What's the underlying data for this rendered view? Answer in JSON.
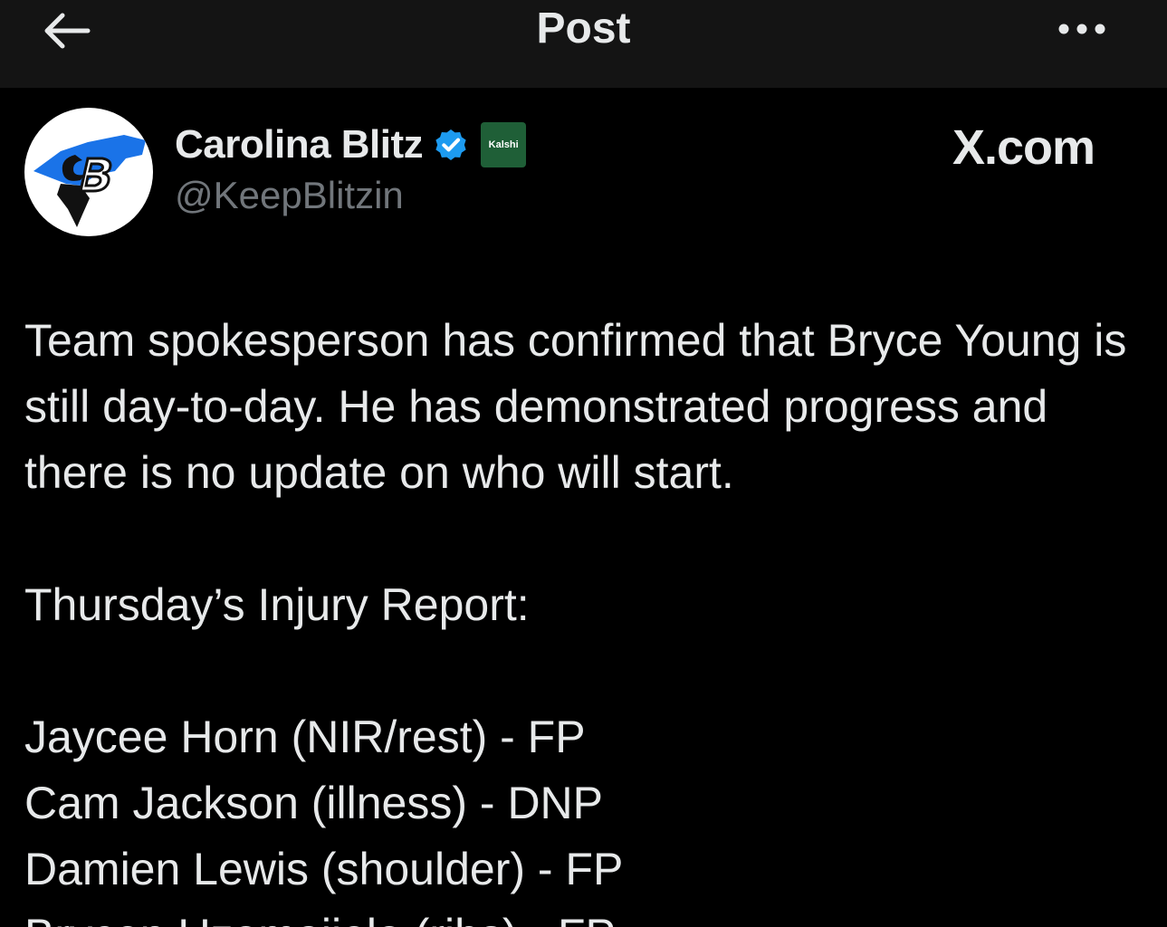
{
  "topbar": {
    "title": "Post",
    "back_icon": "arrow-left-icon",
    "more_icon": "more-horizontal-icon"
  },
  "author": {
    "display_name": "Carolina Blitz",
    "handle": "@KeepBlitzin",
    "verified_color": "#1d9bf0",
    "affiliate_badge": "Kalshi",
    "avatar_text": "CB"
  },
  "watermark": "X.com",
  "post": {
    "intro": "Team spokesperson has confirmed that Bryce Young is still day-to-day. He has demonstrated progress and there is no update on who will start.",
    "report_heading": "Thursday’s Injury Report:",
    "injuries": [
      "Jaycee Horn (NIR/rest) - FP",
      "Cam Jackson (illness) - DNP",
      "Damien Lewis (shoulder) - FP",
      "Brycen Uzomajielo (ribs) - FP"
    ]
  }
}
